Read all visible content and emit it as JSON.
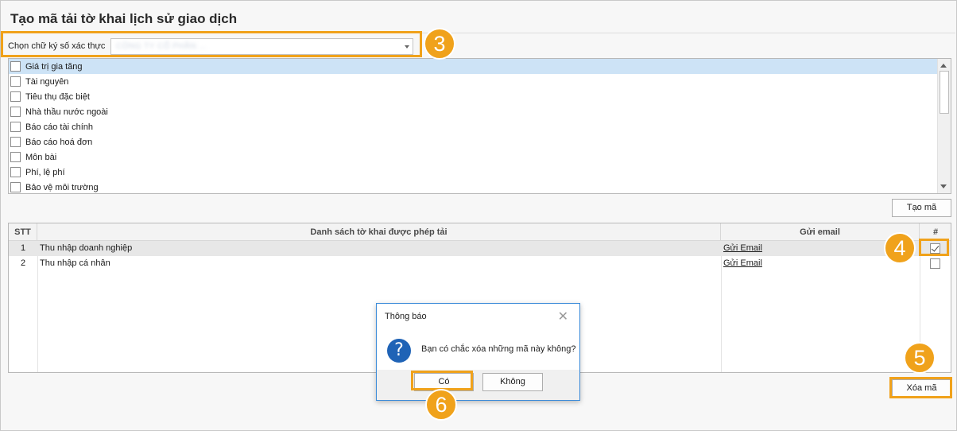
{
  "window": {
    "title": "Tạo mã tải tờ khai lịch sử giao dịch"
  },
  "signature": {
    "label": "Chọn chữ ký số xác thực",
    "value": "CÔNG TY CỔ PHẦN ..."
  },
  "tax_types": [
    {
      "label": "Giá trị gia tăng",
      "selected": true,
      "checked": false
    },
    {
      "label": "Tài nguyên",
      "selected": false,
      "checked": false
    },
    {
      "label": "Tiêu thụ đặc biệt",
      "selected": false,
      "checked": false
    },
    {
      "label": "Nhà thầu nước ngoài",
      "selected": false,
      "checked": false
    },
    {
      "label": "Báo cáo tài chính",
      "selected": false,
      "checked": false
    },
    {
      "label": "Báo cáo hoá đơn",
      "selected": false,
      "checked": false
    },
    {
      "label": "Môn bài",
      "selected": false,
      "checked": false
    },
    {
      "label": "Phí, lệ phí",
      "selected": false,
      "checked": false
    },
    {
      "label": "Bảo vệ môi trường",
      "selected": false,
      "checked": false
    }
  ],
  "buttons": {
    "create": "Tạo mã",
    "delete": "Xóa mã"
  },
  "grid": {
    "headers": {
      "stt": "STT",
      "list": "Danh sách tờ khai được phép tải",
      "email": "Gửi email",
      "check": "#"
    },
    "rows": [
      {
        "stt": "1",
        "name": "Thu nhập doanh nghiệp",
        "email": "Gửi Email",
        "checked": true
      },
      {
        "stt": "2",
        "name": "Thu nhập cá nhân",
        "email": "Gửi Email",
        "checked": false
      }
    ]
  },
  "dialog": {
    "title": "Thông báo",
    "close": "✕",
    "icon": "?",
    "message": "Bạn có chắc xóa những mã này không?",
    "yes": "Có",
    "no": "Không"
  },
  "callouts": {
    "c3": "3",
    "c4": "4",
    "c5": "5",
    "c6": "6"
  },
  "colors": {
    "accent": "#f0a21b",
    "selection": "#cde3f6",
    "dialog_icon": "#1f63b6"
  }
}
